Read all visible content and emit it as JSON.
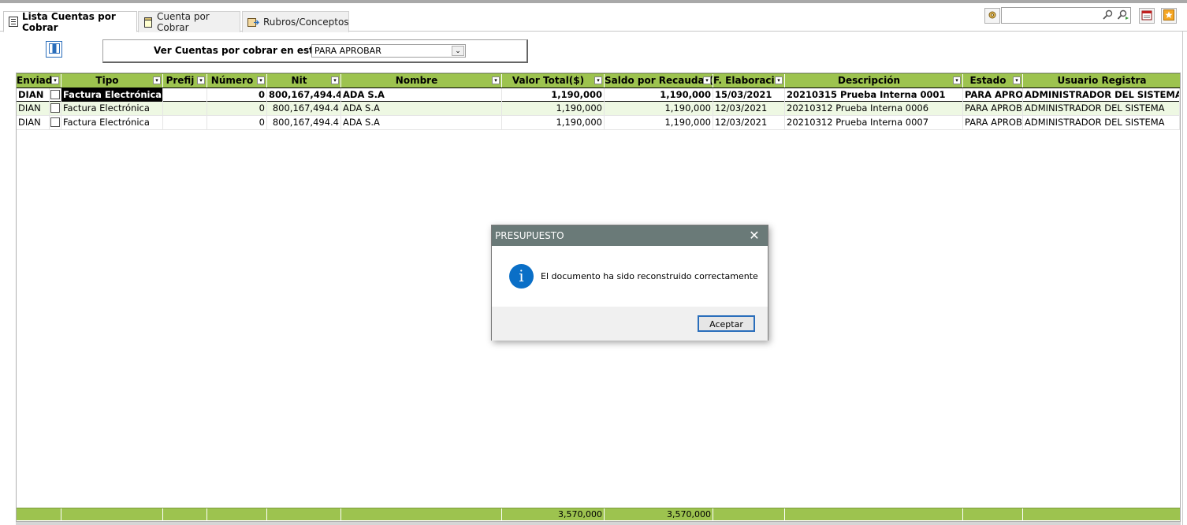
{
  "tabs": [
    {
      "label": "Lista Cuentas por Cobrar",
      "active": true
    },
    {
      "label": "Cuenta por Cobrar",
      "active": false
    },
    {
      "label": "Rubros/Conceptos",
      "active": false
    }
  ],
  "search": {
    "value": "",
    "placeholder": ""
  },
  "filter": {
    "label": "Ver Cuentas por cobrar en estado:",
    "selected": "PARA APROBAR"
  },
  "grid": {
    "columns": [
      "Enviad",
      "Tipo",
      "Prefij",
      "Número",
      "Nit",
      "Nombre",
      "Valor Total($)",
      "Saldo por Recaudar(",
      "F. Elaboracio",
      "Descripción",
      "Estado",
      "Usuario Registra"
    ],
    "rows": [
      {
        "enviado": "DIAN",
        "tipo": "Factura Electrónica",
        "prefijo": "",
        "numero": "0",
        "nit": "800,167,494.4",
        "nombre": "ADA S.A",
        "valor_total": "1,190,000",
        "saldo": "1,190,000",
        "fecha": "15/03/2021",
        "descripcion": "20210315 Prueba Interna 0001",
        "estado": "PARA APROBA",
        "usuario": "ADMINISTRADOR DEL SISTEMA"
      },
      {
        "enviado": "DIAN",
        "tipo": "Factura Electrónica",
        "prefijo": "",
        "numero": "0",
        "nit": "800,167,494.4",
        "nombre": "ADA S.A",
        "valor_total": "1,190,000",
        "saldo": "1,190,000",
        "fecha": "12/03/2021",
        "descripcion": "20210312 Prueba Interna 0006",
        "estado": "PARA APROBA",
        "usuario": "ADMINISTRADOR DEL SISTEMA"
      },
      {
        "enviado": "DIAN",
        "tipo": "Factura Electrónica",
        "prefijo": "",
        "numero": "0",
        "nit": "800,167,494.4",
        "nombre": "ADA S.A",
        "valor_total": "1,190,000",
        "saldo": "1,190,000",
        "fecha": "12/03/2021",
        "descripcion": "20210312 Prueba Interna 0007",
        "estado": "PARA APROBA",
        "usuario": "ADMINISTRADOR DEL SISTEMA"
      }
    ],
    "totals": {
      "valor_total": "3,570,000",
      "saldo": "3,570,000"
    }
  },
  "dialog": {
    "title": "PRESUPUESTO",
    "close": "✕",
    "icon": "info-icon",
    "message": "El documento ha sido reconstruido correctamente",
    "ok_label": "Aceptar"
  },
  "colors": {
    "header_green": "#9dc34f",
    "dialog_title": "#6a7a78",
    "info_blue": "#0a6fc7"
  }
}
